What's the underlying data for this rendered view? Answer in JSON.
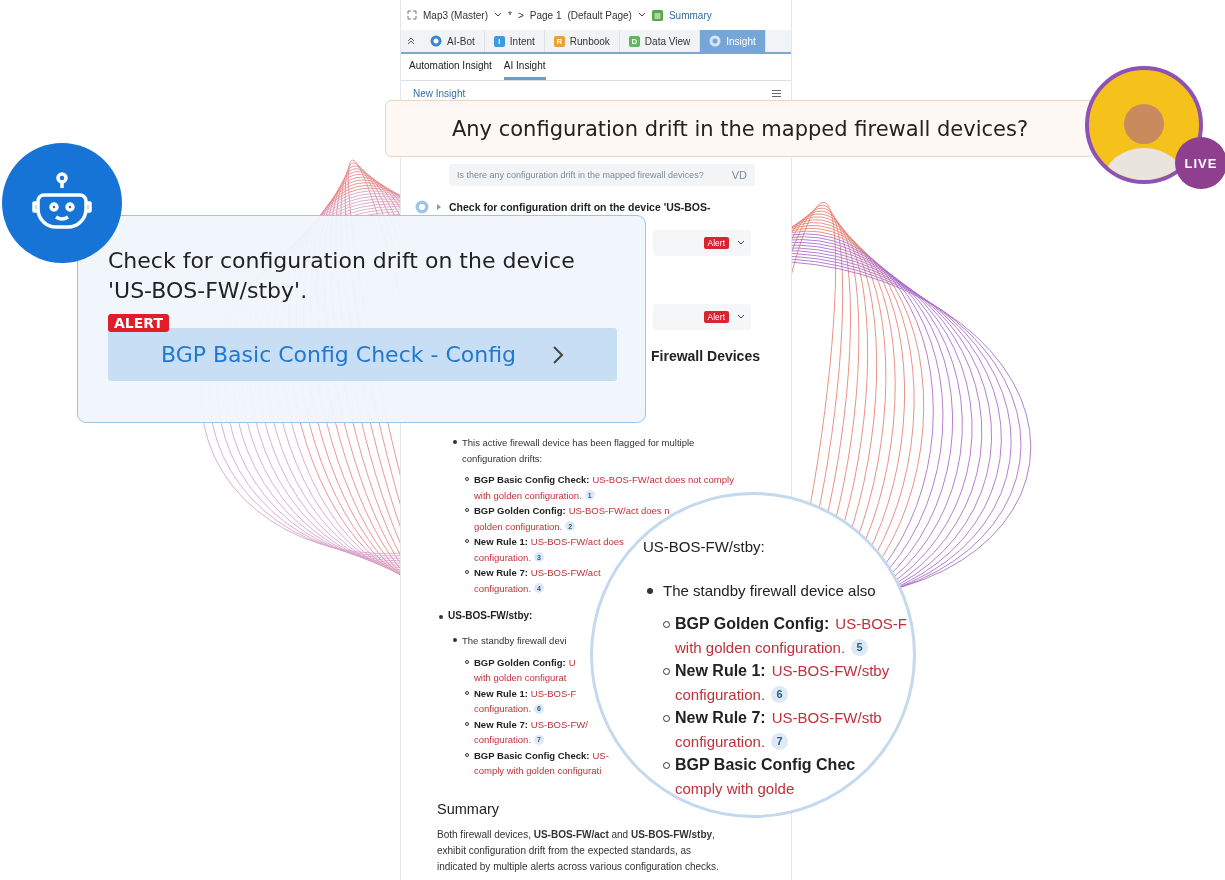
{
  "toolbar": {
    "map": "Map3 (Master)",
    "modified_mark": "*",
    "separator": ">",
    "page": "Page 1",
    "page_type": "(Default Page)",
    "summary": "Summary"
  },
  "tabs": [
    {
      "label": "AI-Bot",
      "kind": "icon",
      "selected": false
    },
    {
      "label": "Intent",
      "kind": "letter",
      "letter": "I",
      "color": "#3b9be0",
      "selected": false
    },
    {
      "label": "Runbook",
      "kind": "letter",
      "letter": "R",
      "color": "#f0a030",
      "selected": false
    },
    {
      "label": "Data View",
      "kind": "letter",
      "letter": "D",
      "color": "#5cb85c",
      "selected": false
    },
    {
      "label": "Insight",
      "kind": "icon",
      "selected": true
    }
  ],
  "subtabs": [
    {
      "label": "Automation Insight",
      "selected": false
    },
    {
      "label": "AI Insight",
      "selected": true
    }
  ],
  "new_insight": "New Insight",
  "question_echo": "Is there any configuration drift in the mapped firewall devices?",
  "user_initials": "VD",
  "step": {
    "title": "Check for configuration drift on the device 'US-BOS-"
  },
  "alerts": [
    "Alert",
    "Alert"
  ],
  "heading_visible": "Firewall Devices",
  "act": {
    "intro": "This active firewall device has been flagged for multiple configuration drifts:",
    "items": [
      {
        "label": "BGP Basic Config Check:",
        "line1": "US-BOS-FW/act does not comply",
        "line2": "with golden configuration.",
        "ref": "1"
      },
      {
        "label": "BGP Golden Config:",
        "line1": "US-BOS-FW/act does n",
        "line2": "golden configuration.",
        "ref": "2"
      },
      {
        "label": "New Rule 1:",
        "line1": "US-BOS-FW/act does",
        "line2": "configuration.",
        "ref": "3"
      },
      {
        "label": "New Rule 7:",
        "line1": "US-BOS-FW/act",
        "line2": "configuration.",
        "ref": "4"
      }
    ]
  },
  "stby": {
    "heading": "US-BOS-FW/stby:",
    "intro": "The standby firewall devi",
    "items": [
      {
        "label": "BGP Golden Config:",
        "line1": "U",
        "line2": "with golden configurat"
      },
      {
        "label": "New Rule 1:",
        "line1": "US-BOS-F",
        "line2": "configuration.",
        "ref": "6"
      },
      {
        "label": "New Rule 7:",
        "line1": "US-BOS-FW/",
        "line2": "configuration.",
        "ref": "7"
      },
      {
        "label": "BGP Basic Config Check:",
        "line1": "US-",
        "line2": "comply with golden configurati"
      }
    ]
  },
  "summary": {
    "heading": "Summary",
    "text": "Both firewall devices, **US-BOS-FW/act** and **US-BOS-FW/stby**, exhibit configuration drift from the expected standards, as indicated by multiple alerts across various configuration checks."
  },
  "magnifier": {
    "heading": "US-BOS-FW/stby:",
    "intro": "The standby firewall device also",
    "items": [
      {
        "label": "BGP Golden Config:",
        "line1": "US-BOS-F",
        "line2": "with golden configuration.",
        "ref": "5"
      },
      {
        "label": "New Rule 1:",
        "line1": "US-BOS-FW/stby",
        "line2": "configuration.",
        "ref": "6"
      },
      {
        "label": "New Rule 7:",
        "line1": "US-BOS-FW/stb",
        "line2": "configuration.",
        "ref": "7"
      },
      {
        "label": "BGP Basic Config Chec",
        "line2": "comply with golde"
      }
    ]
  },
  "question_bubble": "Any configuration drift in the mapped firewall devices?",
  "live_badge": "LIVE",
  "robot_card": {
    "title": "Check for configuration drift on the device 'US-BOS-FW/stby'.",
    "status": "ALERT",
    "check": "BGP Basic Config Check - Config"
  }
}
